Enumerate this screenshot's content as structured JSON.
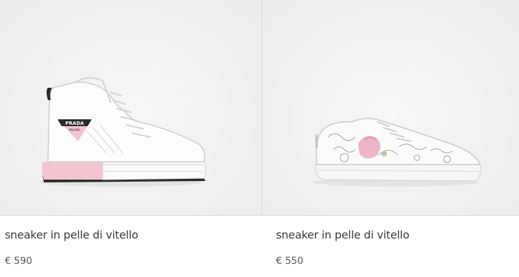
{
  "products": [
    {
      "name": "sneaker in pelle di vitello",
      "price": "€ 590",
      "image": "high-top white leather sneaker with pink triangle logo",
      "logo_text": "PRADA",
      "logo_subtext": "MILANO",
      "accent_color": "#f2c4cf"
    },
    {
      "name": "sneaker in pelle di vitello",
      "price": "€ 550",
      "image": "low-top white sneaker with floral print",
      "accent_color": "#e9a9bd"
    }
  ]
}
